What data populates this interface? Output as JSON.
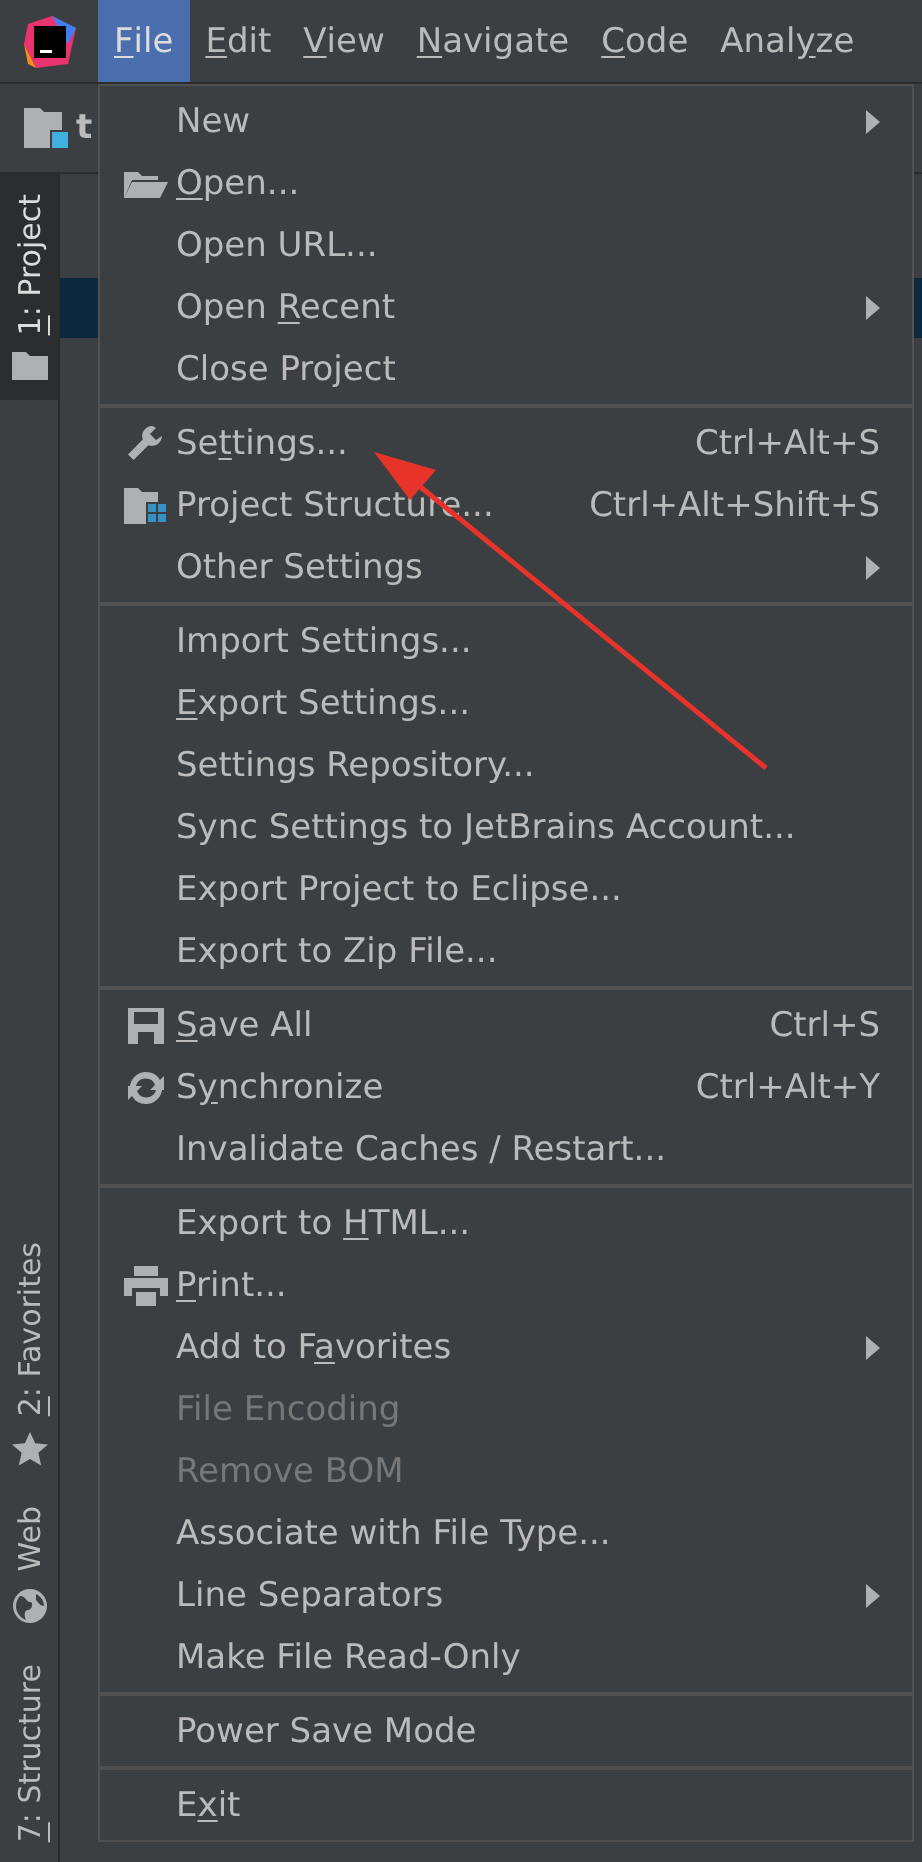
{
  "menubar": [
    {
      "parts": [
        {
          "text": "F",
          "underlined": true
        },
        {
          "text": "ile",
          "underlined": false
        }
      ],
      "selected": true
    },
    {
      "parts": [
        {
          "text": "E",
          "underlined": true
        },
        {
          "text": "dit",
          "underlined": false
        }
      ],
      "selected": false
    },
    {
      "parts": [
        {
          "text": "V",
          "underlined": true
        },
        {
          "text": "iew",
          "underlined": false
        }
      ],
      "selected": false
    },
    {
      "parts": [
        {
          "text": "N",
          "underlined": true
        },
        {
          "text": "avigate",
          "underlined": false
        }
      ],
      "selected": false
    },
    {
      "parts": [
        {
          "text": "C",
          "underlined": true
        },
        {
          "text": "ode",
          "underlined": false
        }
      ],
      "selected": false
    },
    {
      "parts": [
        {
          "text": "Anal",
          "underlined": false
        },
        {
          "text": "y",
          "underlined": true
        },
        {
          "text": "ze",
          "underlined": false
        }
      ],
      "selected": false
    }
  ],
  "toolbar": {
    "project_name": "t"
  },
  "tool_strip": [
    {
      "parts": [
        {
          "text": "1",
          "underlined": true
        },
        {
          "text": ": Project",
          "underlined": false
        }
      ],
      "kind": "folder",
      "selected": true
    },
    {
      "parts": [
        {
          "text": "2",
          "underlined": true
        },
        {
          "text": ": Favorites",
          "underlined": false
        }
      ],
      "kind": "star",
      "selected": false
    },
    {
      "parts": [
        {
          "text": "Web",
          "underlined": false
        }
      ],
      "kind": "globe",
      "selected": false
    },
    {
      "parts": [
        {
          "text": "7",
          "underlined": true
        },
        {
          "text": ": Structure",
          "underlined": false
        }
      ],
      "kind": "plain",
      "selected": false
    }
  ],
  "menu": {
    "groups": [
      {
        "items": [
          {
            "parts": [
              {
                "text": "New",
                "underlined": false
              }
            ],
            "kind": "plain",
            "submenu": true,
            "disabled": false
          },
          {
            "parts": [
              {
                "text": "O",
                "underlined": true
              },
              {
                "text": "pen...",
                "underlined": false
              }
            ],
            "kind": "folder",
            "disabled": false
          },
          {
            "parts": [
              {
                "text": "Open URL...",
                "underlined": false
              }
            ],
            "kind": "plain",
            "disabled": false
          },
          {
            "parts": [
              {
                "text": "Open ",
                "underlined": false
              },
              {
                "text": "R",
                "underlined": true
              },
              {
                "text": "ecent",
                "underlined": false
              }
            ],
            "kind": "plain",
            "submenu": true,
            "disabled": false
          },
          {
            "parts": [
              {
                "text": "Close Project",
                "underlined": false
              }
            ],
            "kind": "plain",
            "disabled": false
          }
        ]
      },
      {
        "items": [
          {
            "parts": [
              {
                "text": "Se",
                "underlined": false
              },
              {
                "text": "t",
                "underlined": true
              },
              {
                "text": "tings...",
                "underlined": false
              }
            ],
            "kind": "wrench",
            "shortcut": "Ctrl+Alt+S",
            "disabled": false
          },
          {
            "parts": [
              {
                "text": "Project Structure...",
                "underlined": false
              }
            ],
            "kind": "structure",
            "shortcut": "Ctrl+Alt+Shift+S",
            "disabled": false
          },
          {
            "parts": [
              {
                "text": "Other Settings",
                "underlined": false
              }
            ],
            "kind": "plain",
            "submenu": true,
            "disabled": false
          }
        ]
      },
      {
        "items": [
          {
            "parts": [
              {
                "text": "Import Settings...",
                "underlined": false
              }
            ],
            "kind": "plain",
            "disabled": false
          },
          {
            "parts": [
              {
                "text": "E",
                "underlined": true
              },
              {
                "text": "xport Settings...",
                "underlined": false
              }
            ],
            "kind": "plain",
            "disabled": false
          },
          {
            "parts": [
              {
                "text": "Settings Repository...",
                "underlined": false
              }
            ],
            "kind": "plain",
            "disabled": false
          },
          {
            "parts": [
              {
                "text": "Sync Settings to JetBrains Account...",
                "underlined": false
              }
            ],
            "kind": "plain",
            "disabled": false
          },
          {
            "parts": [
              {
                "text": "Export Project to Eclipse...",
                "underlined": false
              }
            ],
            "kind": "plain",
            "disabled": false
          },
          {
            "parts": [
              {
                "text": "Export to Zip File...",
                "underlined": false
              }
            ],
            "kind": "plain",
            "disabled": false
          }
        ]
      },
      {
        "items": [
          {
            "parts": [
              {
                "text": "S",
                "underlined": true
              },
              {
                "text": "ave All",
                "underlined": false
              }
            ],
            "kind": "save",
            "shortcut": "Ctrl+S",
            "disabled": false
          },
          {
            "parts": [
              {
                "text": "S",
                "underlined": false
              },
              {
                "text": "y",
                "underlined": true
              },
              {
                "text": "nchronize",
                "underlined": false
              }
            ],
            "kind": "sync",
            "shortcut": "Ctrl+Alt+Y",
            "disabled": false
          },
          {
            "parts": [
              {
                "text": "Invalidate Caches / Restart...",
                "underlined": false
              }
            ],
            "kind": "plain",
            "disabled": false
          }
        ]
      },
      {
        "items": [
          {
            "parts": [
              {
                "text": "Export to ",
                "underlined": false
              },
              {
                "text": "H",
                "underlined": true
              },
              {
                "text": "TML...",
                "underlined": false
              }
            ],
            "kind": "plain",
            "disabled": false
          },
          {
            "parts": [
              {
                "text": "P",
                "underlined": true
              },
              {
                "text": "rint...",
                "underlined": false
              }
            ],
            "kind": "printer",
            "disabled": false
          },
          {
            "parts": [
              {
                "text": "Add to F",
                "underlined": false
              },
              {
                "text": "a",
                "underlined": true
              },
              {
                "text": "vorites",
                "underlined": false
              }
            ],
            "kind": "plain",
            "submenu": true,
            "disabled": false
          },
          {
            "parts": [
              {
                "text": "File Encoding",
                "underlined": false
              }
            ],
            "kind": "plain",
            "disabled": true
          },
          {
            "parts": [
              {
                "text": "Remove BOM",
                "underlined": false
              }
            ],
            "kind": "plain",
            "disabled": true
          },
          {
            "parts": [
              {
                "text": "Associate with File Type...",
                "underlined": false
              }
            ],
            "kind": "plain",
            "disabled": false
          },
          {
            "parts": [
              {
                "text": "Line Separators",
                "underlined": false
              }
            ],
            "kind": "plain",
            "submenu": true,
            "disabled": false
          },
          {
            "parts": [
              {
                "text": "Make File Read-Only",
                "underlined": false
              }
            ],
            "kind": "plain",
            "disabled": false
          }
        ]
      },
      {
        "items": [
          {
            "parts": [
              {
                "text": "Power Save Mode",
                "underlined": false
              }
            ],
            "kind": "plain",
            "disabled": false
          }
        ]
      },
      {
        "items": [
          {
            "parts": [
              {
                "text": "E",
                "underlined": false
              },
              {
                "text": "x",
                "underlined": true
              },
              {
                "text": "it",
                "underlined": false
              }
            ],
            "kind": "plain",
            "disabled": false
          }
        ]
      }
    ]
  }
}
